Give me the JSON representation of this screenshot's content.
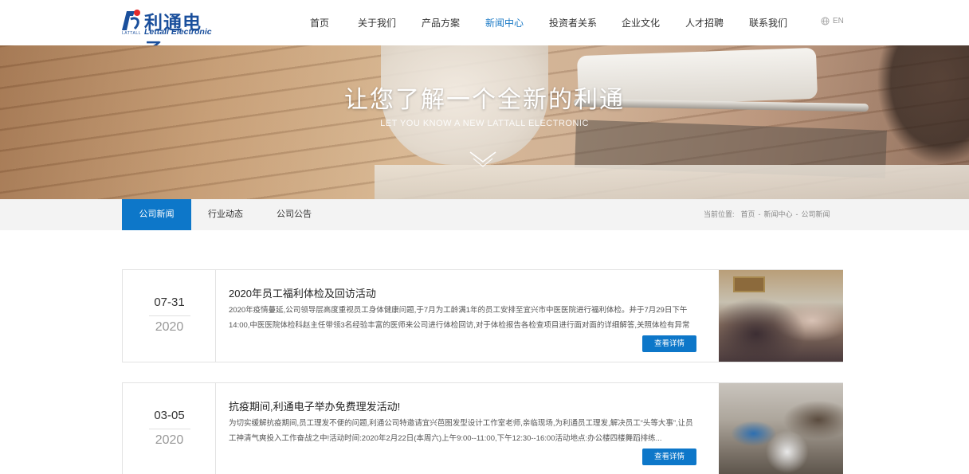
{
  "brand": {
    "name_cn": "利通电子",
    "name_en": "Lettall Electronic",
    "sub": "LATTALL",
    "color": "#1a4f9c"
  },
  "nav": {
    "items": [
      {
        "label": "首页",
        "active": false
      },
      {
        "label": "关于我们",
        "active": false
      },
      {
        "label": "产品方案",
        "active": false
      },
      {
        "label": "新闻中心",
        "active": true
      },
      {
        "label": "投资者关系",
        "active": false
      },
      {
        "label": "企业文化",
        "active": false
      },
      {
        "label": "人才招聘",
        "active": false
      },
      {
        "label": "联系我们",
        "active": false
      }
    ],
    "lang": "EN",
    "accent": "#1b7ac6"
  },
  "banner": {
    "title": "让您了解一个全新的利通",
    "subtitle": "LET YOU KNOW A NEW LATTALL ELECTRONIC"
  },
  "subnav": {
    "tabs": [
      {
        "label": "公司新闻",
        "active": true
      },
      {
        "label": "行业动态",
        "active": false
      },
      {
        "label": "公司公告",
        "active": false
      }
    ],
    "breadcrumb": {
      "prefix": "当前位置:",
      "items": [
        "首页",
        "新闻中心",
        "公司新闻"
      ],
      "sep": "-"
    },
    "accent": "#0d77c9"
  },
  "news": [
    {
      "date": "07-31",
      "year": "2020",
      "title": "2020年员工福利体检及回访活动",
      "summary": "2020年疫情蔓延,公司领导层高度重视员工身体健康问题,于7月为工龄满1年的员工安排至宜兴市中医医院进行福利体检。并于7月29日下午14:00,中医医院体检科赵主任带领3名经验丰富的医师来公司进行体检回访,对于体检报告各检查项目进行面对面的详细解答,关照体检有异常人员...",
      "more": "查看详情",
      "image": "health-check-photo"
    },
    {
      "date": "03-05",
      "year": "2020",
      "title": "抗疫期间,利通电子举办免费理发活动!",
      "summary": "为切实缓解抗疫期间,员工理发不便的问题,利通公司特邀请宜兴芭图发型设计工作室老师,亲临现场,为利通员工理发,解决员工“头等大事”,让员工神清气爽投入工作奋战之中!活动时间:2020年2月22日(本周六)上午9:00--11:00,下午12:30--16:00活动地点:办公楼四楼舞蹈排练...",
      "more": "查看详情",
      "image": "haircut-event-photo"
    }
  ]
}
